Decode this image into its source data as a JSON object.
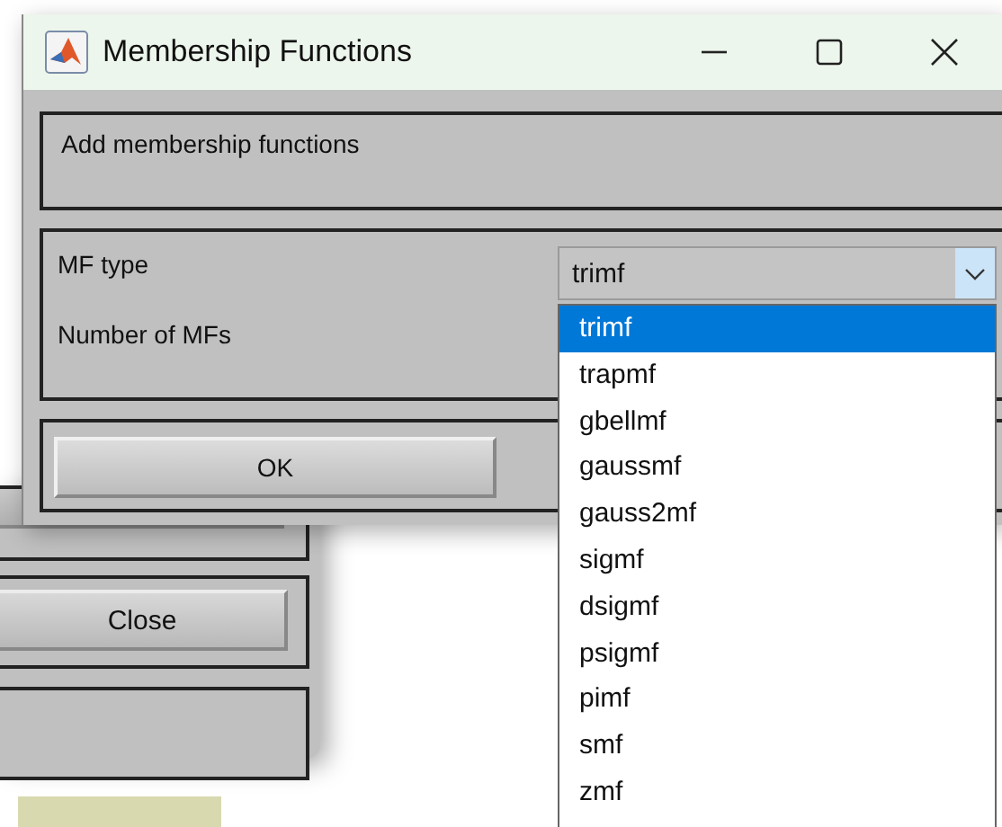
{
  "background_window": {
    "buttons": [
      {
        "label": "Close"
      }
    ]
  },
  "dialog": {
    "title": "Membership Functions",
    "header": "Add membership functions",
    "fields": [
      {
        "label": "MF type"
      },
      {
        "label": "Number of MFs"
      }
    ],
    "mf_type": {
      "value": "trimf",
      "expanded": true,
      "options": [
        {
          "label": "trimf",
          "selected": true
        },
        {
          "label": "trapmf",
          "selected": false
        },
        {
          "label": "gbellmf",
          "selected": false
        },
        {
          "label": "gaussmf",
          "selected": false
        },
        {
          "label": "gauss2mf",
          "selected": false
        },
        {
          "label": "sigmf",
          "selected": false
        },
        {
          "label": "dsigmf",
          "selected": false
        },
        {
          "label": "psigmf",
          "selected": false
        },
        {
          "label": "pimf",
          "selected": false
        },
        {
          "label": "smf",
          "selected": false
        },
        {
          "label": "zmf",
          "selected": false
        }
      ]
    },
    "buttons": [
      {
        "label": "OK"
      }
    ]
  }
}
